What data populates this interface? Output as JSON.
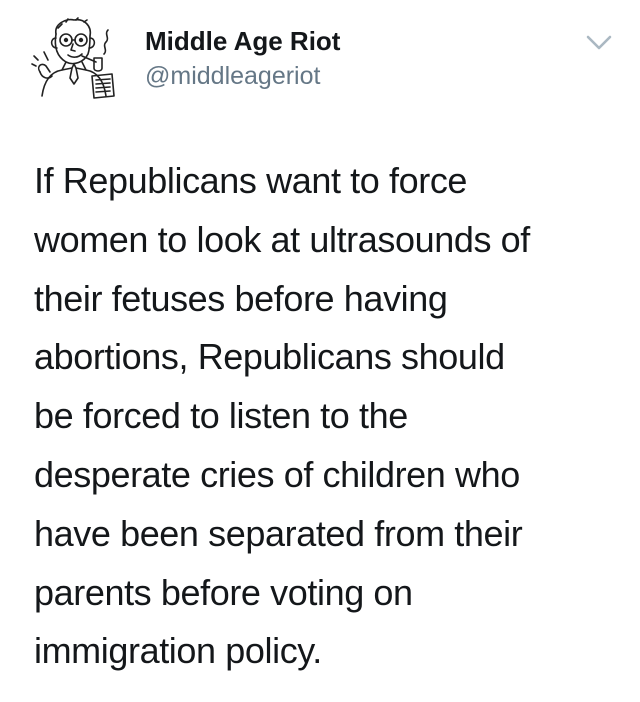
{
  "author": {
    "display_name": "Middle Age Riot",
    "handle": "@middleageriot",
    "avatar_icon": "cartoon-man-with-pipe-avatar"
  },
  "menu": {
    "icon": "chevron-down-icon"
  },
  "tweet": {
    "lines": [
      "If Republicans want to force",
      "women to look at ultrasounds of",
      "their fetuses before having",
      "abortions, Republicans should",
      "be forced to listen to the",
      "desperate cries of children who",
      "have been separated from their",
      "parents before voting on",
      "immigration policy."
    ]
  },
  "colors": {
    "text": "#14171a",
    "secondary": "#657786",
    "chevron": "#aab8c2"
  }
}
